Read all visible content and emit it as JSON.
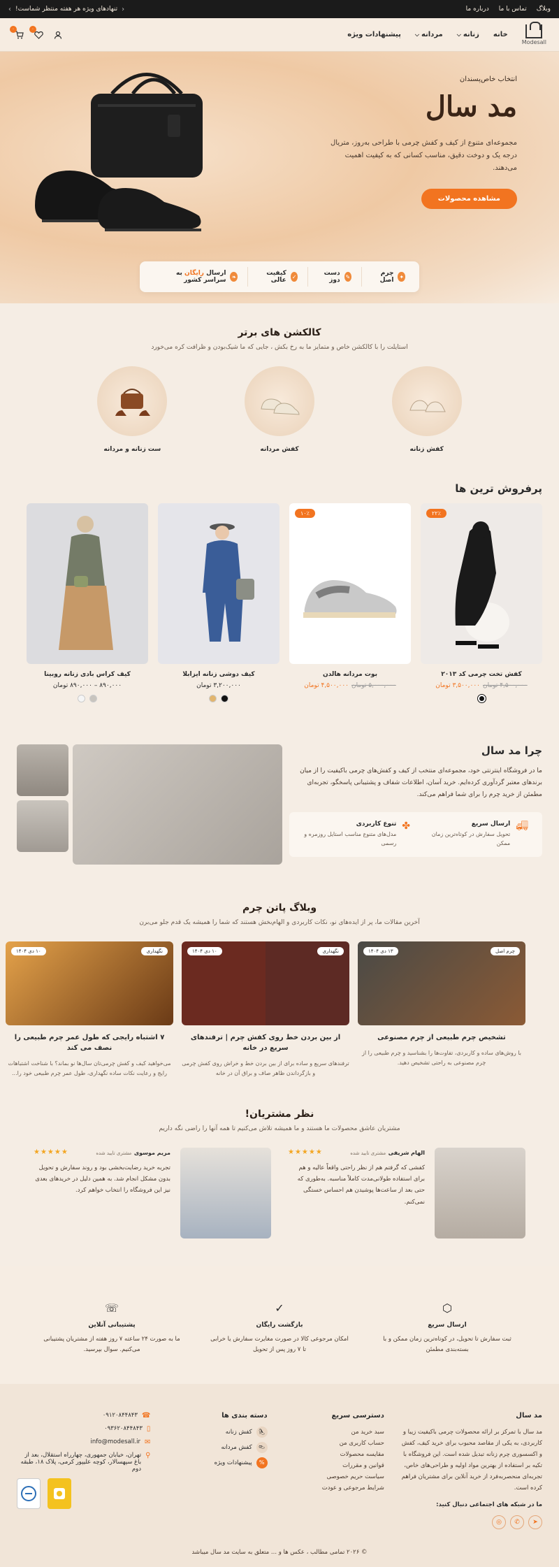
{
  "topbar": {
    "promo": "تنهادهای ویژه هر هفته منتظر شماست!",
    "links": [
      "وبلاگ",
      "تماس با ما",
      "درباره ما"
    ]
  },
  "header": {
    "logo_text": "Modesall",
    "nav": [
      {
        "label": "خانه"
      },
      {
        "label": "زنانه"
      },
      {
        "label": "مردانه"
      },
      {
        "label": "پیشنهادات ویژه"
      }
    ],
    "cart_count": "۰",
    "wishlist_count": "۰"
  },
  "hero": {
    "kicker": "انتخاب خاص‌پسندان",
    "title": "مد سال",
    "description": "مجموعه‌ای متنوع از کیف و کفش چرمی با طراحی به‌روز، متریال درجه یک و دوخت دقیق، مناسب کسانی که به کیفیت اهمیت می‌دهند.",
    "cta": "مشاهده محصولات",
    "features": [
      {
        "label": "چرم اصل"
      },
      {
        "label": "دست دوز"
      },
      {
        "label": "کیفیت عالی"
      },
      {
        "label_pre": "ارسال ",
        "label_accent": "رایگان",
        "label_post": " به سراسر کشور"
      }
    ]
  },
  "collections": {
    "title": "کالکشن های برتر",
    "subtitle": "استایلت را با کالکشن خاص و متمایز ما به رخ بکش ، جایی که ما شیک‌بودن و ظرافت کره می‌خورد",
    "items": [
      {
        "label": "کفش زنانه"
      },
      {
        "label": "کفش مردانه"
      },
      {
        "label": "ست زنانه و مردانه"
      }
    ]
  },
  "bestsellers": {
    "title": "پرفروش ترین ها",
    "products": [
      {
        "name": "کفش تخت چرمی کد ۲۰۱۳",
        "old_price": "۴,۵۰۰,۰۰۰ تومان",
        "new_price": "۳,۵۰۰,۰۰۰ تومان",
        "discount": "۲۲٪"
      },
      {
        "name": "بوت مردانه هالدن",
        "old_price": "۵,۰۰۰,۰۰۰ تومان",
        "new_price": "۴,۵۰۰,۰۰۰ تومان",
        "discount": "۱۰٪"
      },
      {
        "name": "کیف دوشی زنانه ایزابلا",
        "old_price": "",
        "new_price": "۳,۲۰۰,۰۰۰ تومان",
        "discount": ""
      },
      {
        "name": "کیف کراس بادی زنانه روبینا",
        "old_price": "",
        "new_price": "۸۹۰,۰۰۰ – ۸۹۰,۰۰۰ تومان",
        "discount": ""
      }
    ]
  },
  "why": {
    "title": "چرا مد سال",
    "text": "ما در فروشگاه اینترنتی خود، مجموعه‌ای منتخب از کیف و کفش‌های چرمی باکیفیت را از میان برندهای معتبر گردآوری کرده‌ایم. خرید آسان، اطلاعات شفاف و پشتیبانی پاسخگو، تجربه‌ای مطمئن از خرید چرم را برای شما فراهم می‌کند.",
    "boxes": [
      {
        "title": "ارسال سریع",
        "desc": "تحویل سفارش در کوتاه‌ترین زمان ممکن"
      },
      {
        "title": "تنوع کاربردی",
        "desc": "مدل‌های متنوع مناسب استایل روزمره و رسمی"
      }
    ]
  },
  "blog": {
    "title": "وبلاگ پاتن چرم",
    "subtitle": "آخرین مقالات ما، پر از ایده‌های نو، نکات کاربردی و الهام‌بخش هستند که شما را همیشه یک قدم جلو می‌برن",
    "posts": [
      {
        "tag": "چرم اصل",
        "date": "۱۳ دی ۱۴۰۴",
        "title": "تشخیص چرم طبیعی از چرم مصنوعی",
        "excerpt": "با روش‌های ساده و کاربردی، تفاوت‌ها را بشناسید و چرم طبیعی را از چرم مصنوعی به راحتی تشخیص دهید."
      },
      {
        "tag": "نگهداری",
        "date": "۱۰ دی ۱۴۰۴",
        "title": "از بین بردن خط روی کفش چرم | ترفندهای سریع در خانه",
        "excerpt": "ترفندهای سریع و ساده برای از بین بردن خط و خراش روی کفش چرمی و بازگرداندن ظاهر صاف و براق آن در خانه"
      },
      {
        "tag": "نگهداری",
        "date": "۱۰ دی ۱۴۰۴",
        "title": "۷ اشتباه رایجی که طول عمر چرم طبیعی را نصف می کند",
        "excerpt": "می‌خواهید کیف و کفش چرمی‌تان سال‌ها نو بماند؟ با شناخت اشتباهات رایج و رعایت نکات ساده نگهداری، طول عمر چرم طبیعی خود را..."
      }
    ]
  },
  "reviews": {
    "title": "نظر مشتریان!",
    "subtitle": "مشتریان عاشق محصولات ما هستند و ما همیشه تلاش می‌کنیم تا همه آنها را راضی نگه داریم",
    "items": [
      {
        "name": "الهام شریفی",
        "verified": "مشتری تایید شده",
        "stars": "★★★★★",
        "text": "کفشی که گرفتم هم از نظر راحتی واقعاً عالیه و هم برای استفاده طولانی‌مدت کاملاً مناسبه. به‌طوری که حتی بعد از ساعت‌ها پوشیدن هم احساس خستگی نمی‌کنم."
      },
      {
        "name": "مریم موسوی",
        "verified": "مشتری تایید شده",
        "stars": "★★★★★",
        "text": "تجربه خرید رضایت‌بخشی بود و روند سفارش و تحویل بدون مشکل انجام شد. به همین دلیل در خریدهای بعدی نیز این فروشگاه را انتخاب خواهم کرد."
      }
    ]
  },
  "services": [
    {
      "title": "ارسال سریع",
      "desc": "ثبت سفارش تا تحویل، در کوتاه‌ترین زمان ممکن و با بسته‌بندی مطمئن"
    },
    {
      "title": "بازگشت رایگان",
      "desc": "امکان مرجوعی کالا در صورت مغایرت سفارش یا خرابی تا ۷ روز پس از تحویل"
    },
    {
      "title": "پشتیبانی آنلاین",
      "desc": "ما به صورت ۲۴ ساعته ۷ روز هفته از مشتریان پشتیبانی می‌کنیم. سوال بپرسید."
    }
  ],
  "footer": {
    "about_title": "مد سال",
    "about_text": "مد سال با تمرکز بر ارائه محصولات چرمی باکیفیت زیبا و کاربردی، به یکی از مقاصد محبوب برای خرید کیف، کفش و اکسسوری چرم زنانه تبدیل شده است. این فروشگاه با تکیه بر استفاده از بهترین مواد اولیه و طراحی‌های خاص، تجربه‌ای منحصربه‌فرد از خرید آنلاین برای مشتریان فراهم کرده است.",
    "social_title": "ما در شبکه های اجتماعی دنبال کنید:",
    "quick_title": "دسترسی سریع",
    "quick_links": [
      "سبد خرید من",
      "حساب کاربری من",
      "مقایسه محصولات",
      "قوانین و مقررات",
      "سیاست حریم خصوصی",
      "شرایط مرجوعی و عودت"
    ],
    "cat_title": "دسته بندی ها",
    "categories": [
      "کفش زنانه",
      "کفش مردانه",
      "پیشنهادات ویژه"
    ],
    "phone1": "۰۹۱۲۰۸۴۴۸۴۳",
    "phone2": "۰۹۳۶۲۰۸۴۴۸۴۳",
    "email": "info@modesall.ir",
    "address": "تهران، خیابان جمهوری، چهارراه استقلال، بعد از باغ سپهسالار، کوچه علیپور کرمی، پلاک ۱۸، طبقه دوم",
    "copyright": "© ۲۰۲۶ تمامی مطالب ، عکس ها و ... متعلق به سایت مد سال میباشد"
  }
}
